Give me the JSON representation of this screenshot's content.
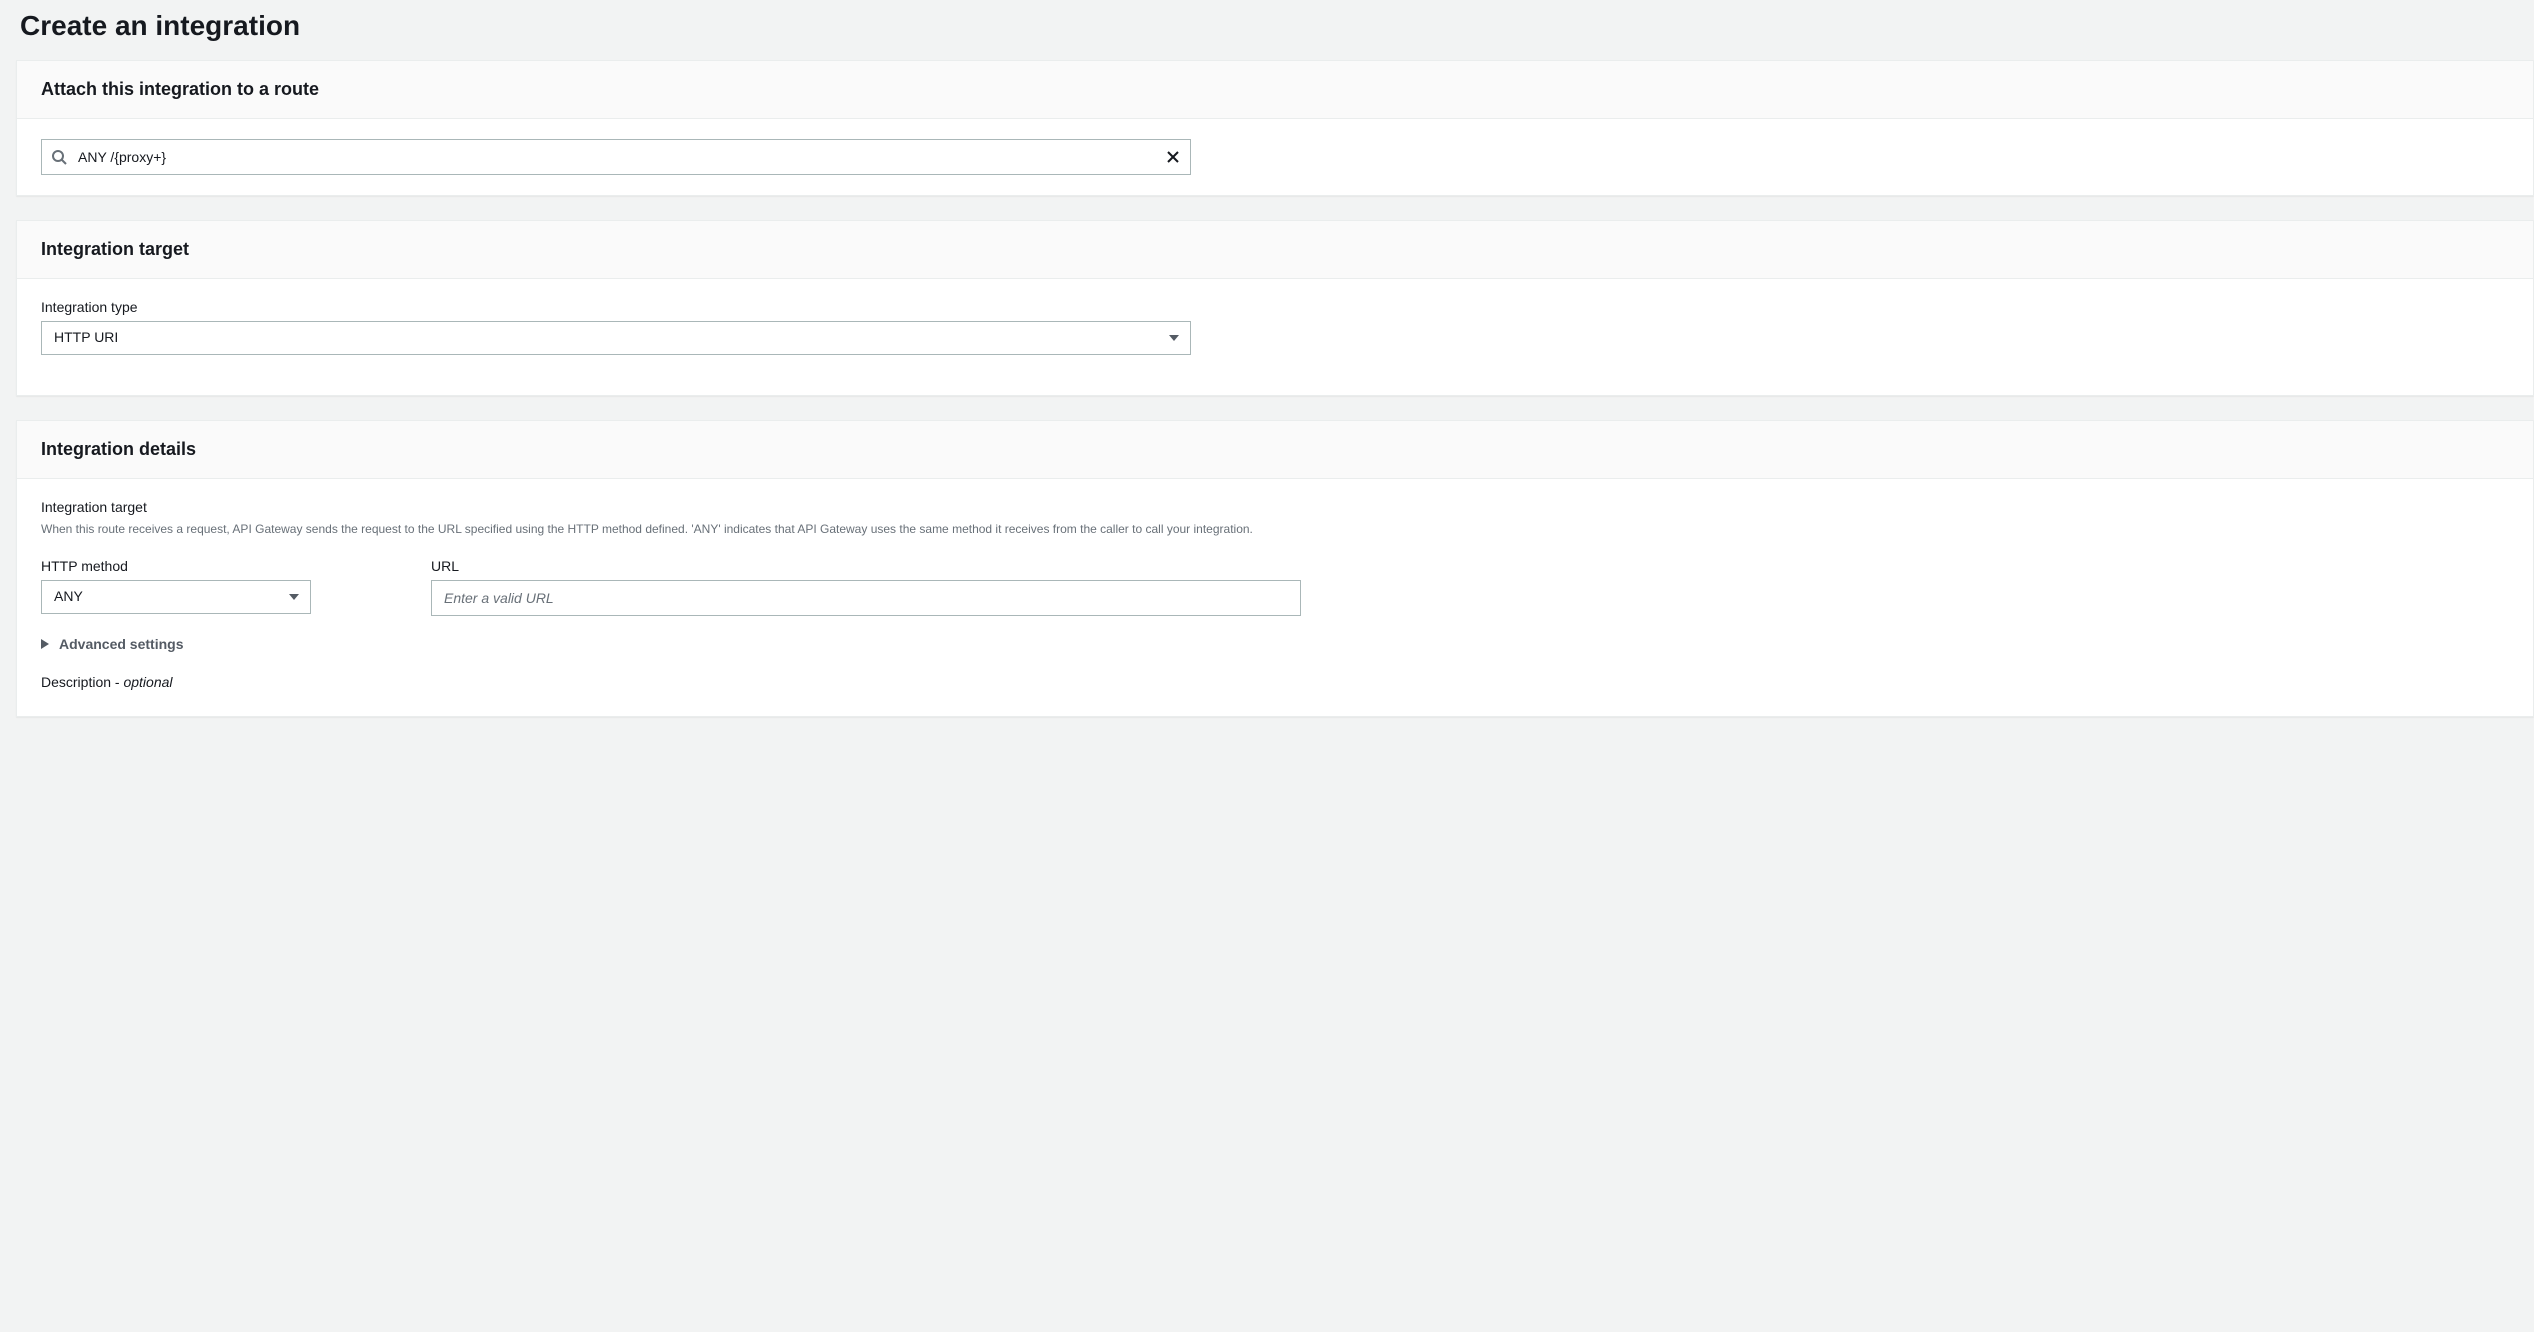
{
  "pageTitle": "Create an integration",
  "sections": {
    "attach": {
      "title": "Attach this integration to a route",
      "searchValue": "ANY /{proxy+}"
    },
    "target": {
      "title": "Integration target",
      "typeLabel": "Integration type",
      "typeValue": "HTTP URI"
    },
    "details": {
      "title": "Integration details",
      "targetLabel": "Integration target",
      "targetHelp": "When this route receives a request, API Gateway sends the request to the URL specified using the HTTP method defined. 'ANY' indicates that API Gateway uses the same method it receives from the caller to call your integration.",
      "methodLabel": "HTTP method",
      "methodValue": "ANY",
      "urlLabel": "URL",
      "urlPlaceholder": "Enter a valid URL",
      "urlValue": "",
      "advancedLabel": "Advanced settings",
      "descriptionLabel": "Description - ",
      "descriptionOptional": "optional"
    }
  }
}
